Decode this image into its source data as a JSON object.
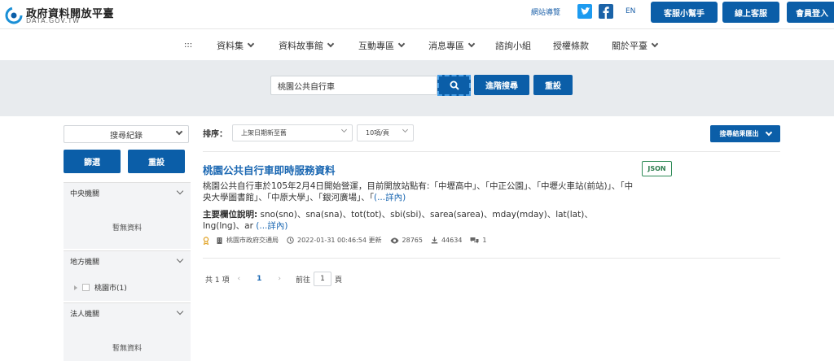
{
  "header": {
    "logo_title": "政府資料開放平臺",
    "logo_sub": "DATA.GOV.TW",
    "sitemap": "網站導覽",
    "lang": "EN",
    "buttons": [
      "客服小幫手",
      "線上客服",
      "會員登入"
    ]
  },
  "nav": {
    "dots": ":::",
    "items": [
      {
        "label": "資料集",
        "dropdown": true
      },
      {
        "label": "資料故事館",
        "dropdown": true
      },
      {
        "label": "互動專區",
        "dropdown": true
      },
      {
        "label": "消息專區",
        "dropdown": true
      },
      {
        "label": "諮詢小組",
        "dropdown": false
      },
      {
        "label": "授權條款",
        "dropdown": false
      },
      {
        "label": "關於平臺",
        "dropdown": true
      }
    ]
  },
  "search": {
    "value": "桃園公共自行車",
    "advanced_label": "進階搜尋",
    "reset_label": "重設"
  },
  "sidebar": {
    "history_label": "搜尋紀錄",
    "filter_label": "篩選",
    "reset_label": "重設",
    "panels": [
      {
        "title": "中央機關",
        "empty": "暫無資料"
      },
      {
        "title": "地方機關",
        "item": "桃園市(1)"
      },
      {
        "title": "法人機關",
        "empty": "暫無資料"
      }
    ]
  },
  "toolbar": {
    "sort_label": "排序：",
    "sort_value": "上架日期新至舊",
    "page_size": "10項/頁",
    "export_label": "搜尋結果匯出"
  },
  "result": {
    "title": "桃園公共自行車即時服務資料",
    "format": "JSON",
    "description": "桃園公共自行車於105年2月4日開始營運，目前開放站點有:「中壢高中」、「中正公園」、「中壢火車站(前站)」、「中央大學圖書館」、「中原大學」、「銀河廣場」、「",
    "description_more": "(...詳內)",
    "fields_label": "主要欄位說明:",
    "fields": " sno(sno)、sna(sna)、tot(tot)、sbi(sbi)、sarea(sarea)、mday(mday)、lat(lat)、lng(lng)、ar ",
    "fields_more": "(...詳內)",
    "agency": "桃園市政府交通局",
    "updated": "2022-01-31 00:46:54 更新",
    "views": "28765",
    "downloads": "44634",
    "comments": "1"
  },
  "pager": {
    "total": "共 1 項",
    "current_page": "1",
    "goto_label": "前往",
    "goto_value": "1",
    "page_unit": "頁"
  },
  "colors": {
    "primary": "#0b5ea8",
    "link": "#1a67b2",
    "band": "#e8ebee",
    "json_badge": "#2e8b57"
  }
}
